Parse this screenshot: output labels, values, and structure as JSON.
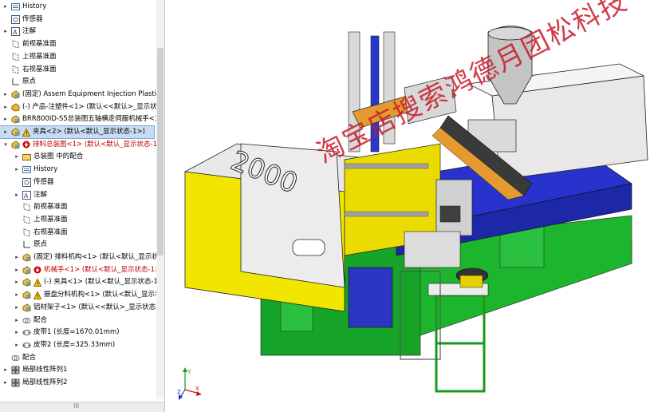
{
  "tree": {
    "items": [
      {
        "label": "History",
        "icon": "history-icon",
        "level": 0,
        "expander": "▸"
      },
      {
        "label": "传感器",
        "icon": "sensor-icon",
        "level": 0,
        "expander": ""
      },
      {
        "label": "注解",
        "icon": "annotation-icon",
        "level": 0,
        "expander": "▸"
      },
      {
        "label": "前视基准面",
        "icon": "plane-icon",
        "level": 0,
        "expander": ""
      },
      {
        "label": "上视基准面",
        "icon": "plane-icon",
        "level": 0,
        "expander": ""
      },
      {
        "label": "右视基准面",
        "icon": "plane-icon",
        "level": 0,
        "expander": ""
      },
      {
        "label": "原点",
        "icon": "origin-icon",
        "level": 0,
        "expander": ""
      },
      {
        "label": "(固定) Assem Equipment Injection Plastic<1",
        "icon": "assembly-icon",
        "level": 0,
        "expander": "▸"
      },
      {
        "label": "(-) 产品-注塑件<1> (默认<<默认>_显示状态",
        "icon": "part-icon",
        "level": 0,
        "expander": "▸"
      },
      {
        "label": "BRR800ID-S5总装图五轴横走伺服机械手<1>",
        "icon": "assembly-icon",
        "level": 0,
        "expander": "▸"
      },
      {
        "label": "夹具<2> (默认<默认_显示状态-1>)",
        "icon": "assembly-warning-icon",
        "level": 0,
        "expander": "▸",
        "selected": true
      },
      {
        "label": "排料总装图<1> (默认<默认_显示状态-1>",
        "icon": "assembly-error-icon",
        "level": 0,
        "expander": "▾",
        "red": true
      },
      {
        "label": "总装图 中的配合",
        "icon": "mate-folder-icon",
        "level": 1,
        "expander": "▸"
      },
      {
        "label": "History",
        "icon": "history-icon",
        "level": 1,
        "expander": "▸"
      },
      {
        "label": "传感器",
        "icon": "sensor-icon",
        "level": 1,
        "expander": ""
      },
      {
        "label": "注解",
        "icon": "annotation-icon",
        "level": 1,
        "expander": "▸"
      },
      {
        "label": "前视基准面",
        "icon": "plane-icon",
        "level": 1,
        "expander": ""
      },
      {
        "label": "上视基准面",
        "icon": "plane-icon",
        "level": 1,
        "expander": ""
      },
      {
        "label": "右视基准面",
        "icon": "plane-icon",
        "level": 1,
        "expander": ""
      },
      {
        "label": "原点",
        "icon": "origin-icon",
        "level": 1,
        "expander": ""
      },
      {
        "label": "(固定) 排料机构<1> (默认<默认_显示状态",
        "icon": "assembly-icon",
        "level": 1,
        "expander": "▸"
      },
      {
        "label": "机械手<1> (默认<默认_显示状态-1>",
        "icon": "assembly-error-icon",
        "level": 1,
        "expander": "▸",
        "red": true
      },
      {
        "label": "(-) 夹具<1> (默认<默认_显示状态-1>",
        "icon": "assembly-warning-icon",
        "level": 1,
        "expander": "▸"
      },
      {
        "label": "振盘分料机构<1> (默认<默认_显示状",
        "icon": "assembly-warning-icon",
        "level": 1,
        "expander": "▸"
      },
      {
        "label": "铝材架子<1> (默认<<默认>_显示状态1",
        "icon": "assembly-icon",
        "level": 1,
        "expander": "▸"
      },
      {
        "label": "配合",
        "icon": "mate-icon",
        "level": 1,
        "expander": "▸"
      },
      {
        "label": "皮带1 (长度=1670.01mm)",
        "icon": "belt-icon",
        "level": 1,
        "expander": "▸"
      },
      {
        "label": "皮带2 (长度=325.33mm)",
        "icon": "belt-icon",
        "level": 1,
        "expander": "▸"
      },
      {
        "label": "配合",
        "icon": "mate-icon",
        "level": 0,
        "expander": ""
      },
      {
        "label": "局部线性阵列1",
        "icon": "pattern-icon",
        "level": 0,
        "expander": "▸"
      },
      {
        "label": "局部线性阵列2",
        "icon": "pattern-icon",
        "level": 0,
        "expander": "▸"
      }
    ],
    "hscroll_label": "III"
  },
  "viewport": {
    "hopper_label": "2000",
    "watermark": "淘宝店搜索鸿德月团松科技",
    "colors": {
      "machine_yellow": "#f2e500",
      "frame_blue": "#2630c8",
      "base_green": "#18b02a",
      "hopper_gray": "#bfbfbf",
      "robot_orange": "#e49a2e",
      "watermark_red": "#c81c2a"
    },
    "triad": {
      "x": "X",
      "y": "Y",
      "z": "Z"
    }
  }
}
